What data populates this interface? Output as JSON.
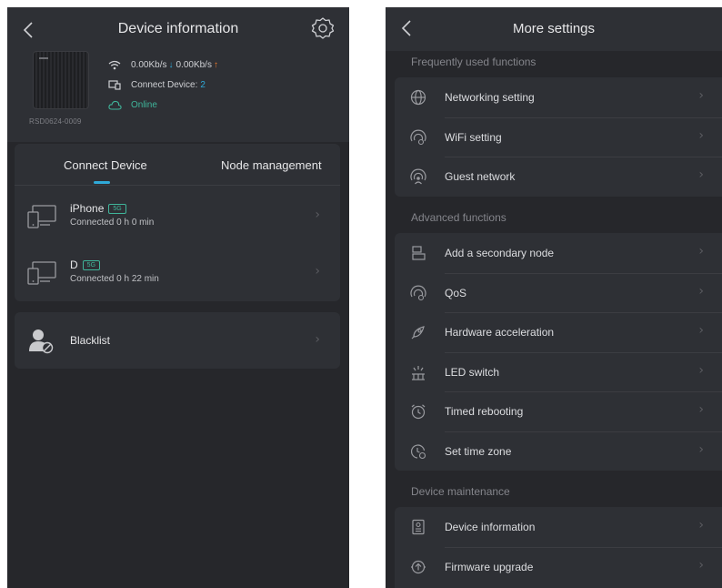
{
  "device_info_screen": {
    "title": "Device information",
    "speed_down": "0.00Kb/s",
    "speed_up": "0.00Kb/s",
    "connect_label": "Connect Device:",
    "connect_count": "2",
    "status": "Online",
    "device_id": "RSD0624-0009",
    "tabs": [
      "Connect Device",
      "Node management"
    ],
    "devices": [
      {
        "name": "iPhone",
        "band": "5G",
        "time": "Connected 0 h 0 min"
      },
      {
        "name": "D",
        "band": "5G",
        "time": "Connected 0 h 22 min"
      }
    ],
    "blacklist": "Blacklist"
  },
  "more_settings_screen": {
    "title": "More settings",
    "sections": [
      {
        "heading": "Frequently used functions",
        "items": [
          "Networking setting",
          "WiFi setting",
          "Guest network"
        ]
      },
      {
        "heading": "Advanced functions",
        "items": [
          "Add a secondary node",
          "QoS",
          "Hardware acceleration",
          "LED switch",
          "Timed rebooting",
          "Set time zone"
        ]
      },
      {
        "heading": "Device maintenance",
        "items": [
          "Device information",
          "Firmware upgrade"
        ]
      }
    ],
    "icons": [
      "globe-icon",
      "wifi-icon",
      "guest-network-icon",
      "secondary-node-icon",
      "qos-icon",
      "rocket-icon",
      "led-icon",
      "alarm-clock-icon",
      "clock-icon",
      "device-info-icon",
      "upgrade-icon"
    ]
  },
  "colors": {
    "accent": "#2fa9d8",
    "online": "#3fb59a",
    "upload": "#ef7a2b",
    "background": "#26272b",
    "card": "#2e3035"
  }
}
